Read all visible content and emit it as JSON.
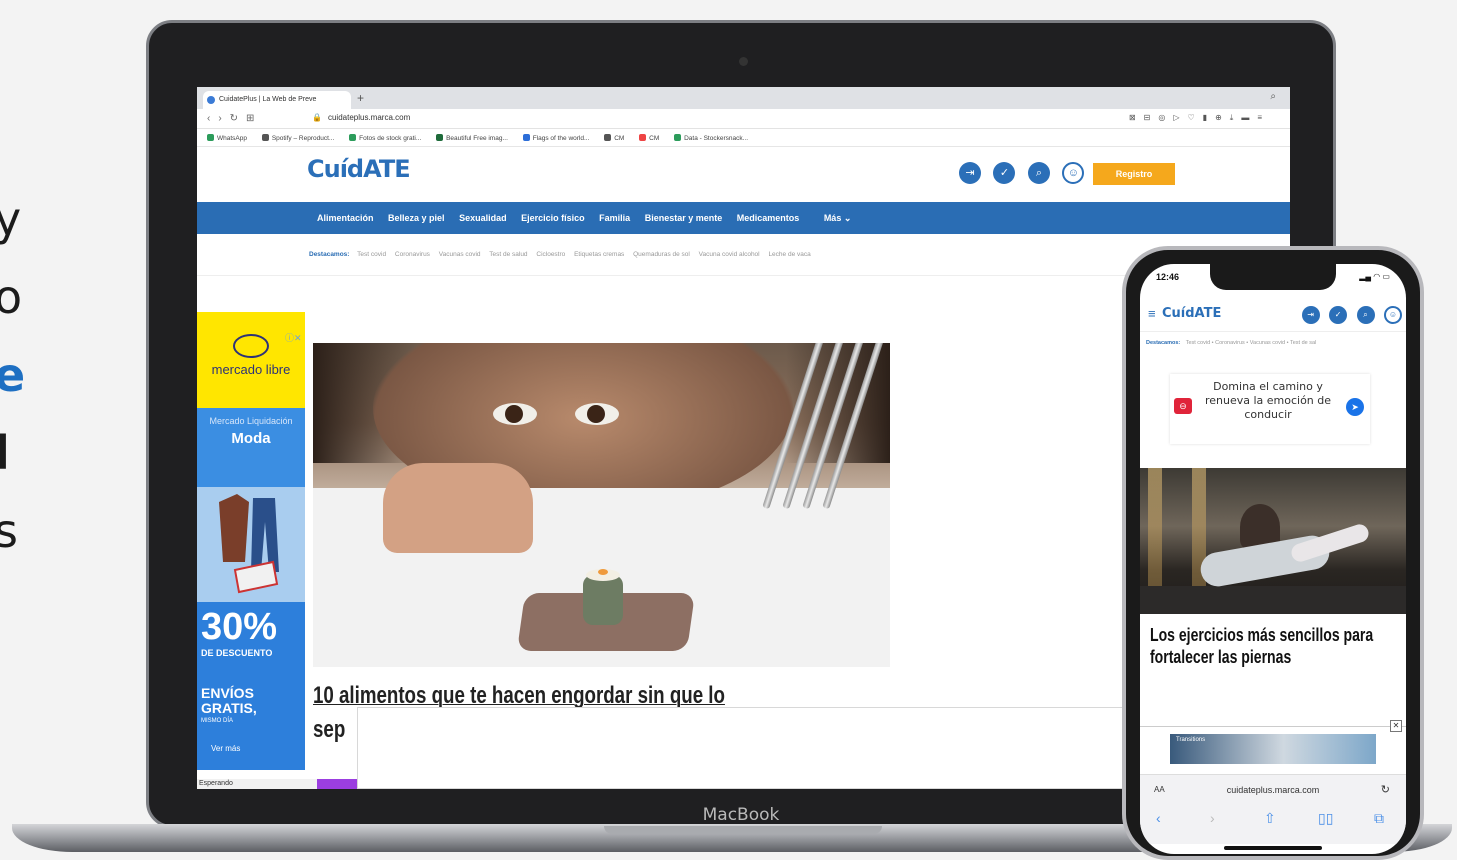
{
  "left_text": {
    "lines": [
      "y",
      "o",
      "e",
      "l",
      "s"
    ]
  },
  "laptop": {
    "brand_label": "MacBook",
    "browser": {
      "tab_title": "CuidatePlus | La Web de Preve",
      "new_tab": "+",
      "address": "cuidateplus.marca.com",
      "bookmarks": [
        "WhatsApp",
        "Spotify – Reproduct...",
        "Fotos de stock grati...",
        "Beautiful Free imag...",
        "Flags of the world...",
        "CM",
        "CM",
        "Data - Stockersnack..."
      ],
      "status_text": "Esperando"
    },
    "site": {
      "logo": "CuídATE",
      "register_button": "Registro",
      "nav": [
        "Alimentación",
        "Belleza y piel",
        "Sexualidad",
        "Ejercicio físico",
        "Familia",
        "Bienestar y mente",
        "Medicamentos"
      ],
      "nav_more": "Más",
      "highlights_label": "Destacamos:",
      "highlights": [
        "Test covid",
        "Coronavirus",
        "Vacunas covid",
        "Test de salud",
        "Cicloestro",
        "Etiquetas cremas",
        "Quemaduras de sol",
        "Vacuna covid alcohol",
        "Leche de vaca"
      ],
      "ad": {
        "brand": "mercado libre",
        "subtitle": "Mercado Liquidación",
        "category": "Moda",
        "discount": "30%",
        "discount_label": "DE DESCUENTO",
        "shipping": "ENVÍOS GRATIS,",
        "same_day": "MISMO DÍA",
        "cta": "Ver más"
      },
      "headline_line1": "10 alimentos que te hacen engordar sin que lo",
      "headline_line2": "sep"
    }
  },
  "phone": {
    "time": "12:46",
    "logo": "CuídATE",
    "highlights_label": "Destacamos:",
    "highlights": "Test covid • Coronavirus • Vacunas covid • Test de sal",
    "ad_text": "Domina el camino y renueva la emoción de conducir",
    "article_title": "Los ejercicios más sencillos para fortalecer las piernas",
    "banner_text": "Transitions",
    "url_aa": "AA",
    "url": "cuidateplus.marca.com"
  },
  "colors": {
    "brand_blue": "#2a6db4",
    "register_orange": "#f5a81c",
    "accent_blue_text": "#1e6fc2"
  }
}
